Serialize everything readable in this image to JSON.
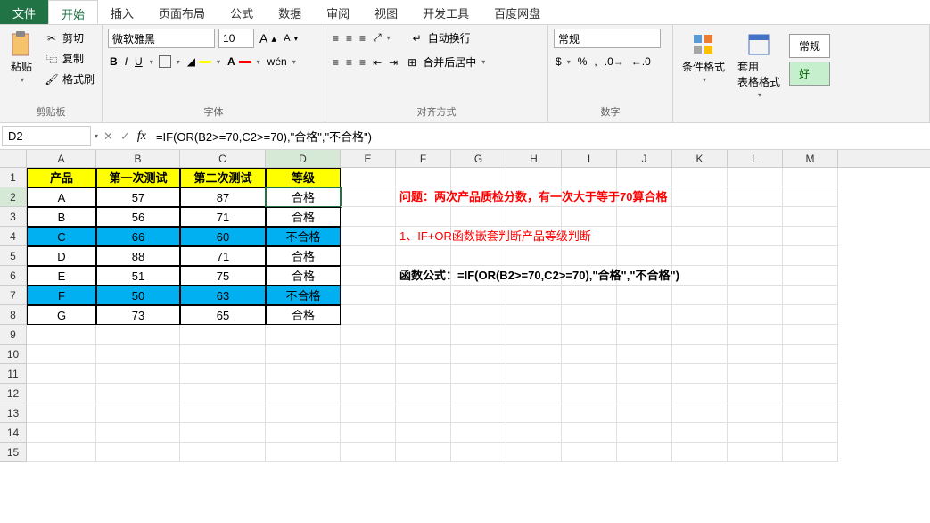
{
  "tabs": {
    "file": "文件",
    "items": [
      "开始",
      "插入",
      "页面布局",
      "公式",
      "数据",
      "审阅",
      "视图",
      "开发工具",
      "百度网盘"
    ],
    "active": "开始"
  },
  "ribbon": {
    "clipboard": {
      "label": "剪贴板",
      "paste": "粘贴",
      "cut": "剪切",
      "copy": "复制",
      "format_painter": "格式刷"
    },
    "font": {
      "label": "字体",
      "name": "微软雅黑",
      "size": "10",
      "bold": "B",
      "italic": "I",
      "underline": "U"
    },
    "alignment": {
      "label": "对齐方式",
      "wrap": "自动换行",
      "merge": "合并后居中"
    },
    "number": {
      "label": "数字",
      "format": "常规"
    },
    "styles": {
      "conditional": "条件格式",
      "table": "套用\n表格格式",
      "normal": "常规",
      "good": "好"
    }
  },
  "namebox": "D2",
  "formula": "=IF(OR(B2>=70,C2>=70),\"合格\",\"不合格\")",
  "columns": [
    "A",
    "B",
    "C",
    "D",
    "E",
    "F",
    "G",
    "H",
    "I",
    "J",
    "K",
    "L",
    "M"
  ],
  "table": {
    "headers": [
      "产品",
      "第一次测试",
      "第二次测试",
      "等级"
    ],
    "rows": [
      {
        "p": "A",
        "t1": "57",
        "t2": "87",
        "g": "合格",
        "hl": false
      },
      {
        "p": "B",
        "t1": "56",
        "t2": "71",
        "g": "合格",
        "hl": false
      },
      {
        "p": "C",
        "t1": "66",
        "t2": "60",
        "g": "不合格",
        "hl": true
      },
      {
        "p": "D",
        "t1": "88",
        "t2": "71",
        "g": "合格",
        "hl": false
      },
      {
        "p": "E",
        "t1": "51",
        "t2": "75",
        "g": "合格",
        "hl": false
      },
      {
        "p": "F",
        "t1": "50",
        "t2": "63",
        "g": "不合格",
        "hl": true
      },
      {
        "p": "G",
        "t1": "73",
        "t2": "65",
        "g": "合格",
        "hl": false
      }
    ]
  },
  "annotations": {
    "q": "问题：两次产品质检分数，有一次大于等于70算合格",
    "a1": "1、IF+OR函数嵌套判断产品等级判断",
    "a2": "函数公式：=IF(OR(B2>=70,C2>=70),\"合格\",\"不合格\")"
  },
  "row_count": 15
}
